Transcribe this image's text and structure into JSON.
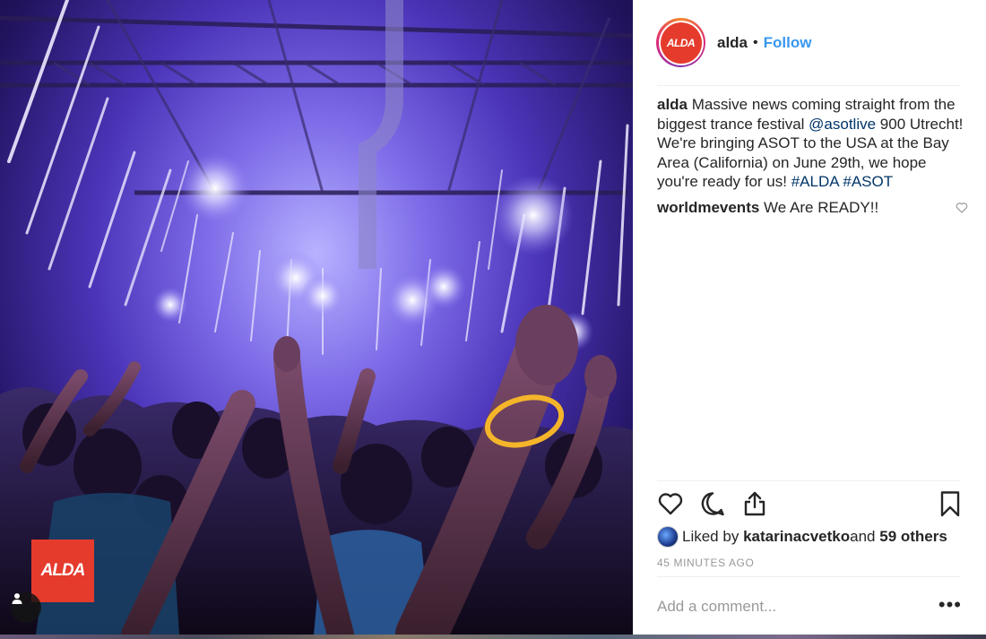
{
  "post": {
    "account": {
      "avatar_logo_text": "ALDA",
      "handle": "alda",
      "separator": "•",
      "follow_label": "Follow"
    },
    "photo": {
      "logo_text": "ALDA",
      "user_tag_icon": "person-icon"
    },
    "caption": {
      "user": "alda",
      "text_1": " Massive news coming straight from the biggest trance festival ",
      "mention": "@asotlive",
      "text_2": " 900 Utrecht! We're bringing ASOT to the USA at the Bay Area (California) on June 29th, we hope you're ready for us! ",
      "hashtag_1": "#ALDA",
      "space": " ",
      "hashtag_2": "#ASOT"
    },
    "comments": [
      {
        "user": "worldmevents",
        "text": " We Are READY!!"
      }
    ],
    "actions": {
      "like_icon": "heart-icon",
      "comment_icon": "comment-icon",
      "share_icon": "share-icon",
      "save_icon": "bookmark-icon"
    },
    "likes": {
      "prefix": "Liked by ",
      "user": "katarinacvetko",
      "middle": " and ",
      "others": "59 others"
    },
    "timestamp": "45 MINUTES AGO",
    "add_comment_placeholder": "Add a comment...",
    "more_label": "•••"
  },
  "colors": {
    "brand_red": "#e53b2c",
    "link_blue": "#3897f0",
    "mention_dark_blue": "#003569",
    "muted_gray": "#999999"
  }
}
